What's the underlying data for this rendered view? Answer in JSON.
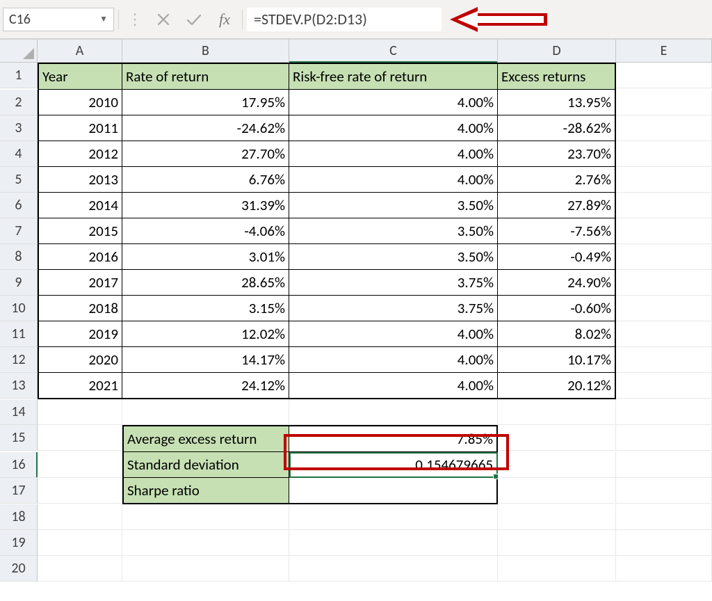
{
  "formula_bar": {
    "name_box": "C16",
    "cancel_icon": "cancel-icon",
    "accept_icon": "accept-icon",
    "fx_label": "fx",
    "formula": "=STDEV.P(D2:D13)"
  },
  "columns": [
    "A",
    "B",
    "C",
    "D",
    "E"
  ],
  "rows_visible": 20,
  "active": {
    "row": 16,
    "col": "C"
  },
  "headers": {
    "A": "Year",
    "B": "Rate of return",
    "C": "Risk-free rate of return",
    "D": "Excess returns"
  },
  "data_rows": [
    {
      "year": "2010",
      "ror": "17.95%",
      "rf": "4.00%",
      "ex": "13.95%"
    },
    {
      "year": "2011",
      "ror": "-24.62%",
      "rf": "4.00%",
      "ex": "-28.62%"
    },
    {
      "year": "2012",
      "ror": "27.70%",
      "rf": "4.00%",
      "ex": "23.70%"
    },
    {
      "year": "2013",
      "ror": "6.76%",
      "rf": "4.00%",
      "ex": "2.76%"
    },
    {
      "year": "2014",
      "ror": "31.39%",
      "rf": "3.50%",
      "ex": "27.89%"
    },
    {
      "year": "2015",
      "ror": "-4.06%",
      "rf": "3.50%",
      "ex": "-7.56%"
    },
    {
      "year": "2016",
      "ror": "3.01%",
      "rf": "3.50%",
      "ex": "-0.49%"
    },
    {
      "year": "2017",
      "ror": "28.65%",
      "rf": "3.75%",
      "ex": "24.90%"
    },
    {
      "year": "2018",
      "ror": "3.15%",
      "rf": "3.75%",
      "ex": "-0.60%"
    },
    {
      "year": "2019",
      "ror": "12.02%",
      "rf": "4.00%",
      "ex": "8.02%"
    },
    {
      "year": "2020",
      "ror": "14.17%",
      "rf": "4.00%",
      "ex": "10.17%"
    },
    {
      "year": "2021",
      "ror": "24.12%",
      "rf": "4.00%",
      "ex": "20.12%"
    }
  ],
  "summary": {
    "avg_label": "Average excess return",
    "avg_value": "7.85%",
    "std_label": "Standard deviation",
    "std_value": "0.154679665",
    "sharpe_label": "Sharpe ratio",
    "sharpe_value": ""
  },
  "colors": {
    "header_fill": "#c6e0b4",
    "selection": "#217346",
    "annotation_red": "#c00000"
  }
}
